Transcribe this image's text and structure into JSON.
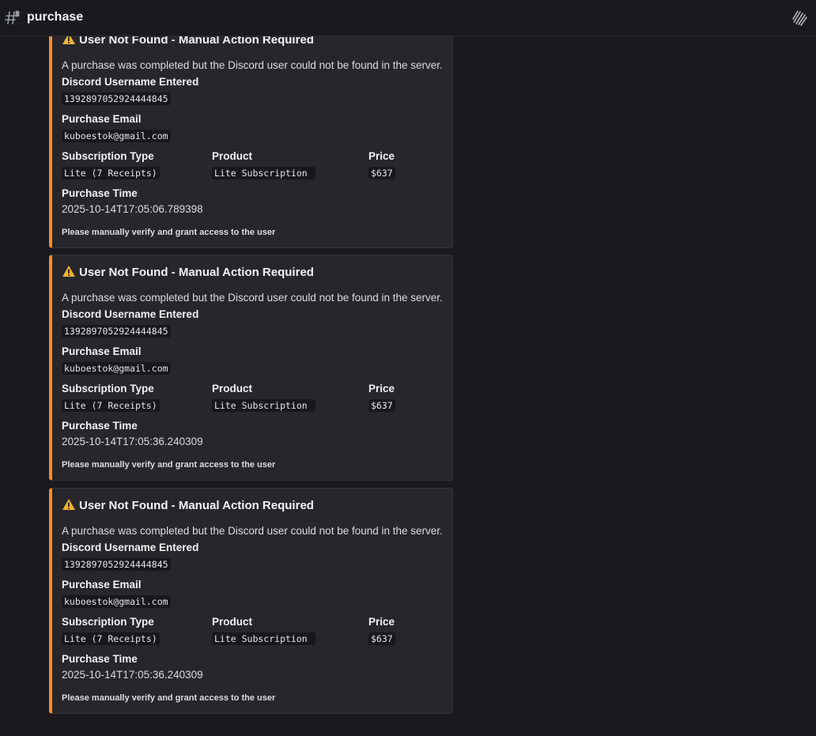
{
  "header": {
    "channel_name": "purchase",
    "channel_icon": "hash-icon",
    "threads_icon": "threads-icon"
  },
  "accent_color": "#f0922b",
  "embeds": [
    {
      "title": "User Not Found - Manual Action Required",
      "description": "A purchase was completed but the Discord user could not be found in the server.",
      "fields": {
        "username_label": "Discord Username Entered",
        "username_value": "1392897052924444845",
        "email_label": "Purchase Email",
        "email_value": "kuboestok@gmail.com",
        "subtype_label": "Subscription Type",
        "subtype_value": "Lite (7 Receipts)",
        "product_label": "Product",
        "product_value": "Lite Subscription ",
        "price_label": "Price",
        "price_value": "$637",
        "time_label": "Purchase Time",
        "time_value": "2025-10-14T17:05:06.789398"
      },
      "footer": "Please manually verify and grant access to the user"
    },
    {
      "title": "User Not Found - Manual Action Required",
      "description": "A purchase was completed but the Discord user could not be found in the server.",
      "fields": {
        "username_label": "Discord Username Entered",
        "username_value": "1392897052924444845",
        "email_label": "Purchase Email",
        "email_value": "kuboestok@gmail.com",
        "subtype_label": "Subscription Type",
        "subtype_value": "Lite (7 Receipts)",
        "product_label": "Product",
        "product_value": "Lite Subscription ",
        "price_label": "Price",
        "price_value": "$637",
        "time_label": "Purchase Time",
        "time_value": "2025-10-14T17:05:36.240309"
      },
      "footer": "Please manually verify and grant access to the user"
    },
    {
      "title": "User Not Found - Manual Action Required",
      "description": "A purchase was completed but the Discord user could not be found in the server.",
      "fields": {
        "username_label": "Discord Username Entered",
        "username_value": "1392897052924444845",
        "email_label": "Purchase Email",
        "email_value": "kuboestok@gmail.com",
        "subtype_label": "Subscription Type",
        "subtype_value": "Lite (7 Receipts)",
        "product_label": "Product",
        "product_value": "Lite Subscription ",
        "price_label": "Price",
        "price_value": "$637",
        "time_label": "Purchase Time",
        "time_value": "2025-10-14T17:05:36.240309"
      },
      "footer": "Please manually verify and grant access to the user"
    }
  ]
}
